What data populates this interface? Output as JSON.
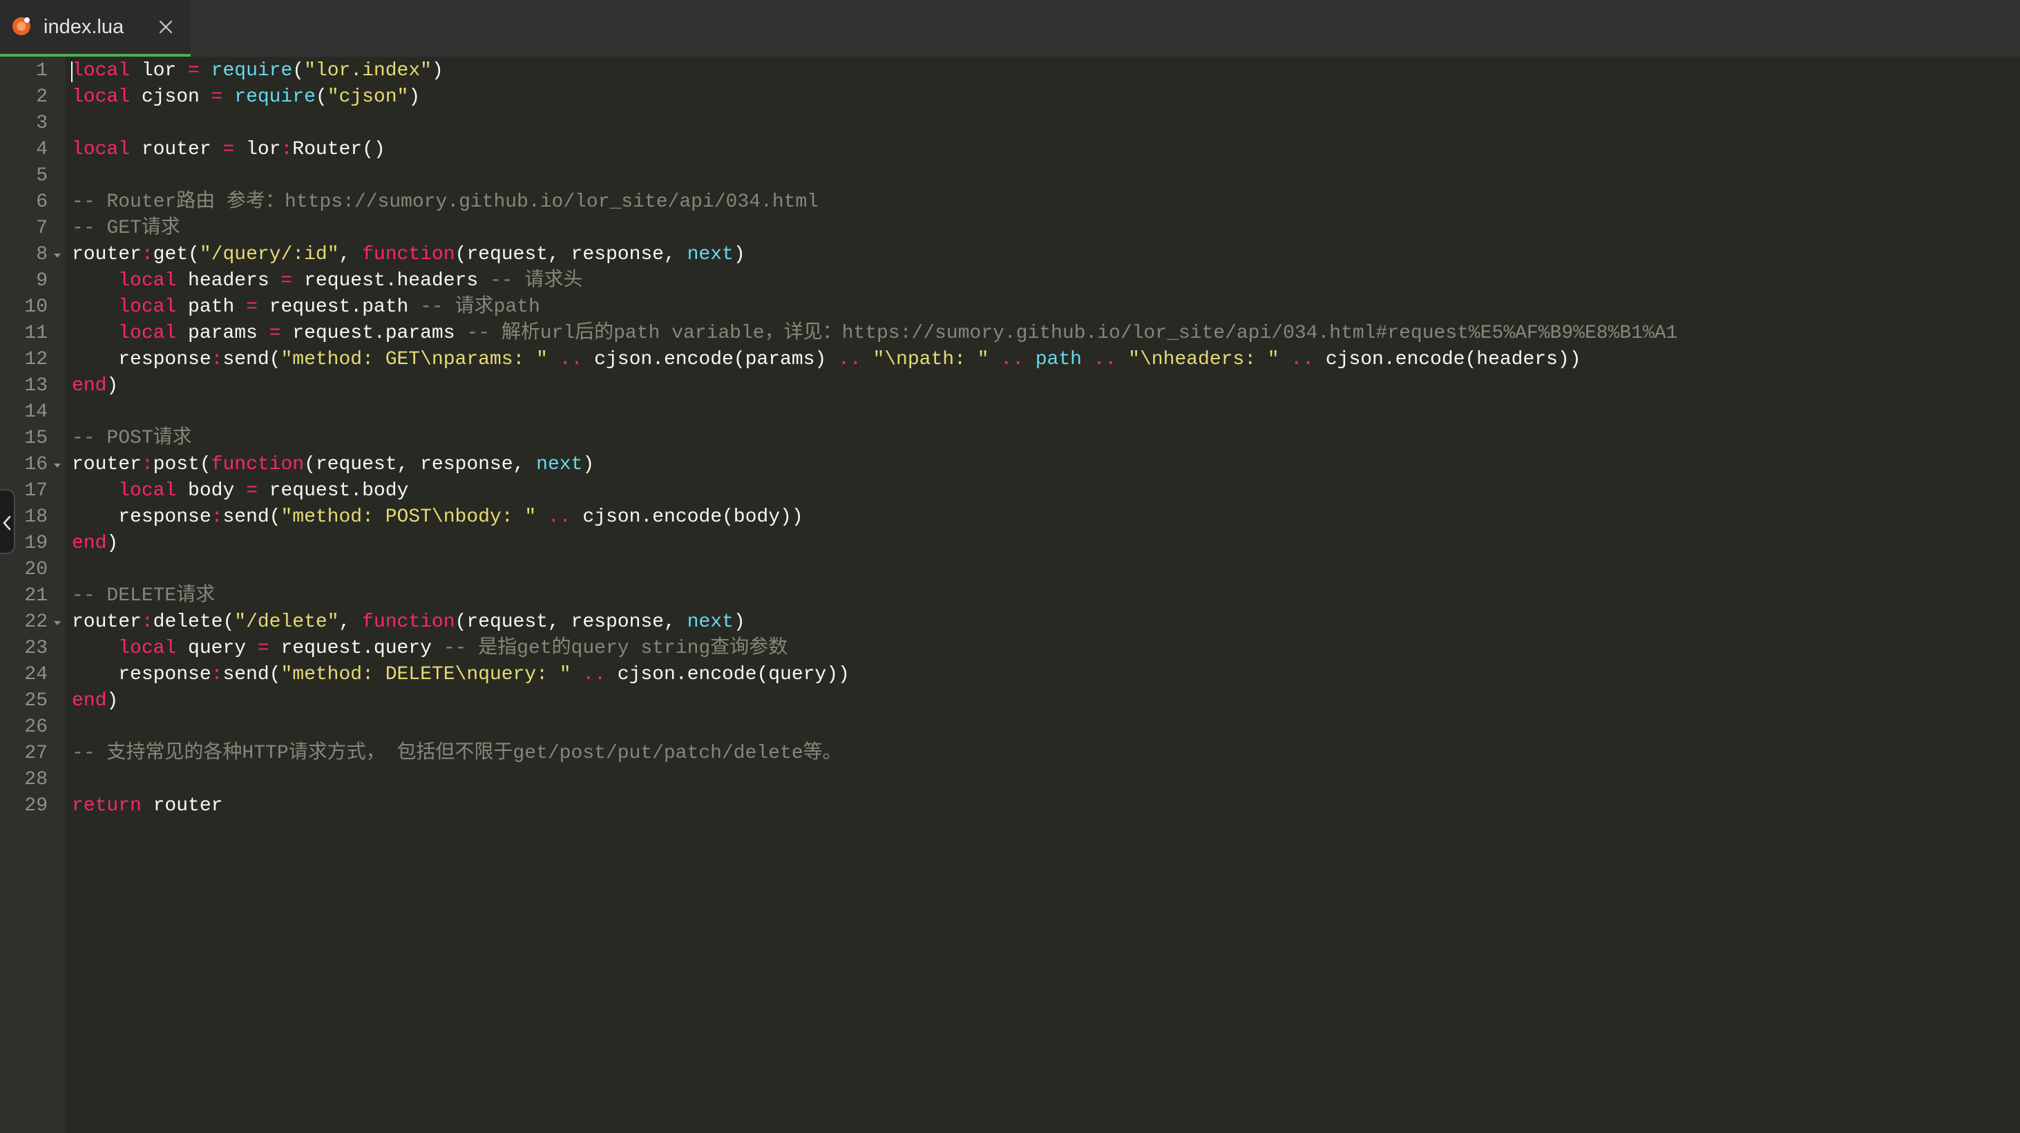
{
  "tab": {
    "title": "index.lua",
    "file_icon": "lua-file-icon",
    "close_icon": "close-icon",
    "active_underline_color": "#4caf50"
  },
  "panel_toggle": {
    "icon": "chevron-left-icon"
  },
  "theme": {
    "background": "#282923",
    "gutter": "#2f302b",
    "line_number": "#8f908a",
    "kw": "#f92672",
    "op": "#f92672",
    "fn": "#66d9ef",
    "str": "#e6db74",
    "cm": "#88867a",
    "id": "#f8f8f2"
  },
  "editor": {
    "lines": [
      {
        "n": "1",
        "tokens": [
          {
            "t": "kw",
            "v": "local"
          },
          {
            "t": "id",
            "v": " lor "
          },
          {
            "t": "op",
            "v": "="
          },
          {
            "t": "id",
            "v": " "
          },
          {
            "t": "fn",
            "v": "require"
          },
          {
            "t": "id",
            "v": "("
          },
          {
            "t": "str",
            "v": "\"lor.index\""
          },
          {
            "t": "id",
            "v": ")"
          }
        ]
      },
      {
        "n": "2",
        "tokens": [
          {
            "t": "kw",
            "v": "local"
          },
          {
            "t": "id",
            "v": " cjson "
          },
          {
            "t": "op",
            "v": "="
          },
          {
            "t": "id",
            "v": " "
          },
          {
            "t": "fn",
            "v": "require"
          },
          {
            "t": "id",
            "v": "("
          },
          {
            "t": "str",
            "v": "\"cjson\""
          },
          {
            "t": "id",
            "v": ")"
          }
        ]
      },
      {
        "n": "3",
        "tokens": []
      },
      {
        "n": "4",
        "tokens": [
          {
            "t": "kw",
            "v": "local"
          },
          {
            "t": "id",
            "v": " router "
          },
          {
            "t": "op",
            "v": "="
          },
          {
            "t": "id",
            "v": " lor"
          },
          {
            "t": "op",
            "v": ":"
          },
          {
            "t": "id",
            "v": "Router()"
          }
        ]
      },
      {
        "n": "5",
        "tokens": []
      },
      {
        "n": "6",
        "tokens": [
          {
            "t": "cm",
            "v": "-- Router路由 参考：https://sumory.github.io/lor_site/api/034.html"
          }
        ]
      },
      {
        "n": "7",
        "tokens": [
          {
            "t": "cm",
            "v": "-- GET请求"
          }
        ]
      },
      {
        "n": "8",
        "fold": true,
        "tokens": [
          {
            "t": "id",
            "v": "router"
          },
          {
            "t": "op",
            "v": ":"
          },
          {
            "t": "id",
            "v": "get("
          },
          {
            "t": "str",
            "v": "\"/query/:id\""
          },
          {
            "t": "id",
            "v": ", "
          },
          {
            "t": "kw",
            "v": "function"
          },
          {
            "t": "id",
            "v": "(request, response, "
          },
          {
            "t": "fn",
            "v": "next"
          },
          {
            "t": "id",
            "v": ")"
          }
        ]
      },
      {
        "n": "9",
        "tokens": [
          {
            "t": "id",
            "v": "    "
          },
          {
            "t": "kw",
            "v": "local"
          },
          {
            "t": "id",
            "v": " headers "
          },
          {
            "t": "op",
            "v": "="
          },
          {
            "t": "id",
            "v": " request.headers "
          },
          {
            "t": "cm",
            "v": "-- 请求头"
          }
        ]
      },
      {
        "n": "10",
        "tokens": [
          {
            "t": "id",
            "v": "    "
          },
          {
            "t": "kw",
            "v": "local"
          },
          {
            "t": "id",
            "v": " path "
          },
          {
            "t": "op",
            "v": "="
          },
          {
            "t": "id",
            "v": " request.path "
          },
          {
            "t": "cm",
            "v": "-- 请求path"
          }
        ]
      },
      {
        "n": "11",
        "tokens": [
          {
            "t": "id",
            "v": "    "
          },
          {
            "t": "kw",
            "v": "local"
          },
          {
            "t": "id",
            "v": " params "
          },
          {
            "t": "op",
            "v": "="
          },
          {
            "t": "id",
            "v": " request.params "
          },
          {
            "t": "cm",
            "v": "-- 解析url后的path variable，详见：https://sumory.github.io/lor_site/api/034.html#request%E5%AF%B9%E8%B1%A1"
          }
        ]
      },
      {
        "n": "12",
        "tokens": [
          {
            "t": "id",
            "v": "    response"
          },
          {
            "t": "op",
            "v": ":"
          },
          {
            "t": "id",
            "v": "send("
          },
          {
            "t": "str",
            "v": "\"method: GET\\nparams: \""
          },
          {
            "t": "id",
            "v": " "
          },
          {
            "t": "op",
            "v": ".."
          },
          {
            "t": "id",
            "v": " cjson.encode(params) "
          },
          {
            "t": "op",
            "v": ".."
          },
          {
            "t": "id",
            "v": " "
          },
          {
            "t": "str",
            "v": "\"\\npath: \""
          },
          {
            "t": "id",
            "v": " "
          },
          {
            "t": "op",
            "v": ".."
          },
          {
            "t": "id",
            "v": " "
          },
          {
            "t": "fn",
            "v": "path"
          },
          {
            "t": "id",
            "v": " "
          },
          {
            "t": "op",
            "v": ".."
          },
          {
            "t": "id",
            "v": " "
          },
          {
            "t": "str",
            "v": "\"\\nheaders: \""
          },
          {
            "t": "id",
            "v": " "
          },
          {
            "t": "op",
            "v": ".."
          },
          {
            "t": "id",
            "v": " cjson.encode(headers))"
          }
        ]
      },
      {
        "n": "13",
        "tokens": [
          {
            "t": "kw",
            "v": "end"
          },
          {
            "t": "id",
            "v": ")"
          }
        ]
      },
      {
        "n": "14",
        "tokens": []
      },
      {
        "n": "15",
        "tokens": [
          {
            "t": "cm",
            "v": "-- POST请求"
          }
        ]
      },
      {
        "n": "16",
        "fold": true,
        "tokens": [
          {
            "t": "id",
            "v": "router"
          },
          {
            "t": "op",
            "v": ":"
          },
          {
            "t": "id",
            "v": "post("
          },
          {
            "t": "kw",
            "v": "function"
          },
          {
            "t": "id",
            "v": "(request, response, "
          },
          {
            "t": "fn",
            "v": "next"
          },
          {
            "t": "id",
            "v": ")"
          }
        ]
      },
      {
        "n": "17",
        "tokens": [
          {
            "t": "id",
            "v": "    "
          },
          {
            "t": "kw",
            "v": "local"
          },
          {
            "t": "id",
            "v": " body "
          },
          {
            "t": "op",
            "v": "="
          },
          {
            "t": "id",
            "v": " request.body"
          }
        ]
      },
      {
        "n": "18",
        "tokens": [
          {
            "t": "id",
            "v": "    response"
          },
          {
            "t": "op",
            "v": ":"
          },
          {
            "t": "id",
            "v": "send("
          },
          {
            "t": "str",
            "v": "\"method: POST\\nbody: \""
          },
          {
            "t": "id",
            "v": " "
          },
          {
            "t": "op",
            "v": ".."
          },
          {
            "t": "id",
            "v": " cjson.encode(body))"
          }
        ]
      },
      {
        "n": "19",
        "tokens": [
          {
            "t": "kw",
            "v": "end"
          },
          {
            "t": "id",
            "v": ")"
          }
        ]
      },
      {
        "n": "20",
        "tokens": []
      },
      {
        "n": "21",
        "tokens": [
          {
            "t": "cm",
            "v": "-- DELETE请求"
          }
        ]
      },
      {
        "n": "22",
        "fold": true,
        "tokens": [
          {
            "t": "id",
            "v": "router"
          },
          {
            "t": "op",
            "v": ":"
          },
          {
            "t": "id",
            "v": "delete("
          },
          {
            "t": "str",
            "v": "\"/delete\""
          },
          {
            "t": "id",
            "v": ", "
          },
          {
            "t": "kw",
            "v": "function"
          },
          {
            "t": "id",
            "v": "(request, response, "
          },
          {
            "t": "fn",
            "v": "next"
          },
          {
            "t": "id",
            "v": ")"
          }
        ]
      },
      {
        "n": "23",
        "tokens": [
          {
            "t": "id",
            "v": "    "
          },
          {
            "t": "kw",
            "v": "local"
          },
          {
            "t": "id",
            "v": " query "
          },
          {
            "t": "op",
            "v": "="
          },
          {
            "t": "id",
            "v": " request.query "
          },
          {
            "t": "cm",
            "v": "-- 是指get的query string查询参数"
          }
        ]
      },
      {
        "n": "24",
        "tokens": [
          {
            "t": "id",
            "v": "    response"
          },
          {
            "t": "op",
            "v": ":"
          },
          {
            "t": "id",
            "v": "send("
          },
          {
            "t": "str",
            "v": "\"method: DELETE\\nquery: \""
          },
          {
            "t": "id",
            "v": " "
          },
          {
            "t": "op",
            "v": ".."
          },
          {
            "t": "id",
            "v": " cjson.encode(query))"
          }
        ]
      },
      {
        "n": "25",
        "tokens": [
          {
            "t": "kw",
            "v": "end"
          },
          {
            "t": "id",
            "v": ")"
          }
        ]
      },
      {
        "n": "26",
        "tokens": []
      },
      {
        "n": "27",
        "tokens": [
          {
            "t": "cm",
            "v": "-- 支持常见的各种HTTP请求方式， 包括但不限于get/post/put/patch/delete等。"
          }
        ]
      },
      {
        "n": "28",
        "tokens": []
      },
      {
        "n": "29",
        "tokens": [
          {
            "t": "kw",
            "v": "return"
          },
          {
            "t": "id",
            "v": " router"
          }
        ]
      }
    ]
  }
}
